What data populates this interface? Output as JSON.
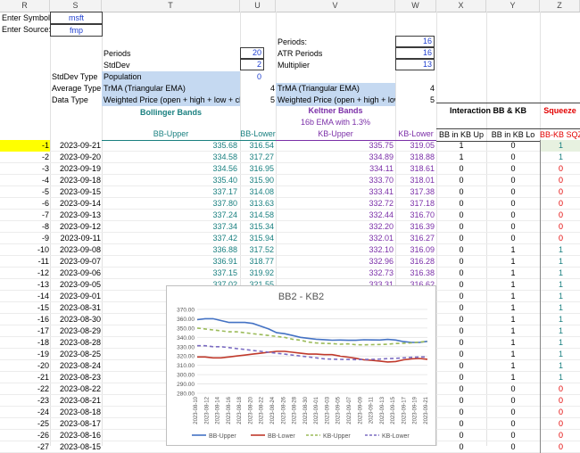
{
  "columns": [
    "R",
    "S",
    "T",
    "U",
    "V",
    "W",
    "X",
    "Y",
    "Z"
  ],
  "inputs": {
    "symbol_label": "Enter Symbol:",
    "symbol_value": "msft",
    "source_label": "Enter Source:",
    "source_value": "fmp"
  },
  "params_bb": {
    "periods_label": "Periods",
    "periods_value": "20",
    "stddev_label": "StdDev",
    "stddev_value": "2",
    "stddev_type_label": "StdDev Type",
    "stddev_type_value": "Population",
    "stddev_type_num": "0",
    "avg_type_label": "Average Type",
    "avg_type_value": "TrMA (Triangular EMA)",
    "avg_type_num": "4",
    "data_type_label": "Data Type",
    "data_type_value": "Weighted Price (open + high + low + clos",
    "data_type_num": "5"
  },
  "params_kb": {
    "periods_label": "Periods:",
    "periods_value": "16",
    "atr_label": "ATR Periods",
    "atr_value": "16",
    "mult_label": "Multiplier",
    "mult_value": "13",
    "avg_type_value": "TrMA (Triangular EMA)",
    "avg_type_num": "4",
    "data_type_value": "Weighted Price (open + high + low +",
    "data_type_num": "5"
  },
  "section_titles": {
    "bollinger": "Bollinger Bands",
    "keltner": "Keltner Bands",
    "keltner_sub": "16b EMA with 1.3%",
    "interaction": "Interaction BB & KB",
    "squeeze": "Squeeze"
  },
  "headers": {
    "bb_upper": "BB-Upper",
    "bb_lower": "BB-Lower",
    "kb_upper": "KB-Upper",
    "kb_lower": "KB-Lower",
    "bb_in_kb_up": "BB in KB Up",
    "bb_in_kb_lo": "BB in KB Lo",
    "sqz": "BB-KB SQZ"
  },
  "rows": [
    {
      "idx": "-1",
      "date": "2023-09-21",
      "bbu": "335.68",
      "bbl": "316.54",
      "kbu": "335.75",
      "kbl": "319.05",
      "up": "1",
      "lo": "0",
      "sqz": "1"
    },
    {
      "idx": "-2",
      "date": "2023-09-20",
      "bbu": "334.58",
      "bbl": "317.27",
      "kbu": "334.89",
      "kbl": "318.88",
      "up": "1",
      "lo": "0",
      "sqz": "1"
    },
    {
      "idx": "-3",
      "date": "2023-09-19",
      "bbu": "334.56",
      "bbl": "316.95",
      "kbu": "334.11",
      "kbl": "318.61",
      "up": "0",
      "lo": "0",
      "sqz": "0"
    },
    {
      "idx": "-4",
      "date": "2023-09-18",
      "bbu": "335.40",
      "bbl": "315.90",
      "kbu": "333.70",
      "kbl": "318.01",
      "up": "0",
      "lo": "0",
      "sqz": "0"
    },
    {
      "idx": "-5",
      "date": "2023-09-15",
      "bbu": "337.17",
      "bbl": "314.08",
      "kbu": "333.41",
      "kbl": "317.38",
      "up": "0",
      "lo": "0",
      "sqz": "0"
    },
    {
      "idx": "-6",
      "date": "2023-09-14",
      "bbu": "337.80",
      "bbl": "313.63",
      "kbu": "332.72",
      "kbl": "317.18",
      "up": "0",
      "lo": "0",
      "sqz": "0"
    },
    {
      "idx": "-7",
      "date": "2023-09-13",
      "bbu": "337.24",
      "bbl": "314.58",
      "kbu": "332.44",
      "kbl": "316.70",
      "up": "0",
      "lo": "0",
      "sqz": "0"
    },
    {
      "idx": "-8",
      "date": "2023-09-12",
      "bbu": "337.34",
      "bbl": "315.34",
      "kbu": "332.20",
      "kbl": "316.39",
      "up": "0",
      "lo": "0",
      "sqz": "0"
    },
    {
      "idx": "-9",
      "date": "2023-09-11",
      "bbu": "337.42",
      "bbl": "315.94",
      "kbu": "332.01",
      "kbl": "316.27",
      "up": "0",
      "lo": "0",
      "sqz": "0"
    },
    {
      "idx": "-10",
      "date": "2023-09-08",
      "bbu": "336.88",
      "bbl": "317.52",
      "kbu": "332.10",
      "kbl": "316.09",
      "up": "0",
      "lo": "1",
      "sqz": "1"
    },
    {
      "idx": "-11",
      "date": "2023-09-07",
      "bbu": "336.91",
      "bbl": "318.77",
      "kbu": "332.96",
      "kbl": "316.28",
      "up": "0",
      "lo": "1",
      "sqz": "1"
    },
    {
      "idx": "-12",
      "date": "2023-09-06",
      "bbu": "337.15",
      "bbl": "319.92",
      "kbu": "332.73",
      "kbl": "316.38",
      "up": "0",
      "lo": "1",
      "sqz": "1"
    },
    {
      "idx": "-13",
      "date": "2023-09-05",
      "bbu": "337.02",
      "bbl": "321.55",
      "kbu": "333.31",
      "kbl": "316.62",
      "up": "0",
      "lo": "1",
      "sqz": "1"
    },
    {
      "idx": "-14",
      "date": "2023-09-01",
      "bbu": "",
      "bbl": "",
      "kbu": "",
      "kbl": "",
      "up": "0",
      "lo": "1",
      "sqz": "1"
    },
    {
      "idx": "-15",
      "date": "2023-08-31",
      "bbu": "",
      "bbl": "",
      "kbu": "",
      "kbl": "",
      "up": "0",
      "lo": "1",
      "sqz": "1"
    },
    {
      "idx": "-16",
      "date": "2023-08-30",
      "bbu": "",
      "bbl": "",
      "kbu": "",
      "kbl": "",
      "up": "0",
      "lo": "1",
      "sqz": "1"
    },
    {
      "idx": "-17",
      "date": "2023-08-29",
      "bbu": "",
      "bbl": "",
      "kbu": "",
      "kbl": "",
      "up": "0",
      "lo": "1",
      "sqz": "1"
    },
    {
      "idx": "-18",
      "date": "2023-08-28",
      "bbu": "",
      "bbl": "",
      "kbu": "",
      "kbl": "",
      "up": "0",
      "lo": "1",
      "sqz": "1"
    },
    {
      "idx": "-19",
      "date": "2023-08-25",
      "bbu": "",
      "bbl": "",
      "kbu": "",
      "kbl": "",
      "up": "0",
      "lo": "1",
      "sqz": "1"
    },
    {
      "idx": "-20",
      "date": "2023-08-24",
      "bbu": "",
      "bbl": "",
      "kbu": "",
      "kbl": "",
      "up": "0",
      "lo": "1",
      "sqz": "1"
    },
    {
      "idx": "-21",
      "date": "2023-08-23",
      "bbu": "",
      "bbl": "",
      "kbu": "",
      "kbl": "",
      "up": "0",
      "lo": "1",
      "sqz": "1"
    },
    {
      "idx": "-22",
      "date": "2023-08-22",
      "bbu": "",
      "bbl": "",
      "kbu": "",
      "kbl": "",
      "up": "0",
      "lo": "0",
      "sqz": "0"
    },
    {
      "idx": "-23",
      "date": "2023-08-21",
      "bbu": "",
      "bbl": "",
      "kbu": "",
      "kbl": "",
      "up": "0",
      "lo": "0",
      "sqz": "0"
    },
    {
      "idx": "-24",
      "date": "2023-08-18",
      "bbu": "",
      "bbl": "",
      "kbu": "",
      "kbl": "",
      "up": "0",
      "lo": "0",
      "sqz": "0"
    },
    {
      "idx": "-25",
      "date": "2023-08-17",
      "bbu": "",
      "bbl": "",
      "kbu": "",
      "kbl": "",
      "up": "0",
      "lo": "0",
      "sqz": "0"
    },
    {
      "idx": "-26",
      "date": "2023-08-16",
      "bbu": "",
      "bbl": "",
      "kbu": "",
      "kbl": "",
      "up": "0",
      "lo": "0",
      "sqz": "0"
    },
    {
      "idx": "-27",
      "date": "2023-08-15",
      "bbu": "",
      "bbl": "",
      "kbu": "",
      "kbl": "",
      "up": "0",
      "lo": "0",
      "sqz": "0"
    }
  ],
  "colors": {
    "highlight": "#ffff00",
    "header_fill": "#c5d9f1",
    "teal": "#1a8080",
    "bb_upper": "#4472c4",
    "bb_lower": "#c0392b",
    "kb_upper": "#9bbb59",
    "kb_lower": "#7b6cc2"
  },
  "chart_data": {
    "type": "line",
    "title": "BB2 - KB2",
    "x": [
      "2023-08-10",
      "2023-08-11",
      "2023-08-14",
      "2023-08-15",
      "2023-08-16",
      "2023-08-17",
      "2023-08-18",
      "2023-08-21",
      "2023-08-22",
      "2023-08-23",
      "2023-08-24",
      "2023-08-25",
      "2023-08-28",
      "2023-08-29",
      "2023-08-30",
      "2023-08-31",
      "2023-09-01",
      "2023-09-05",
      "2023-09-06",
      "2023-09-07",
      "2023-09-08",
      "2023-09-11",
      "2023-09-12",
      "2023-09-13",
      "2023-09-14",
      "2023-09-15",
      "2023-09-18",
      "2023-09-19",
      "2023-09-20",
      "2023-09-21"
    ],
    "xlabels": [
      "2023-08-10",
      "2023-08-12",
      "2023-08-14",
      "2023-08-16",
      "2023-08-18",
      "2023-08-20",
      "2023-08-22",
      "2023-08-24",
      "2023-08-26",
      "2023-08-28",
      "2023-08-30",
      "2023-09-01",
      "2023-09-03",
      "2023-09-05",
      "2023-09-07",
      "2023-09-09",
      "2023-09-11",
      "2023-09-13",
      "2023-09-15",
      "2023-09-17",
      "2023-09-19",
      "2023-09-21"
    ],
    "ylim": [
      280,
      370
    ],
    "yticks": [
      "370.00",
      "360.00",
      "350.00",
      "340.00",
      "330.00",
      "320.00",
      "310.00",
      "300.00",
      "290.00",
      "280.00"
    ],
    "series": [
      {
        "name": "BB-Upper",
        "values": [
          359,
          360,
          360,
          358,
          356,
          356,
          356,
          355,
          352,
          349,
          345,
          344,
          342,
          340,
          339,
          338,
          337.5,
          337,
          337.2,
          336.9,
          336.9,
          337.4,
          337.3,
          337.2,
          337.8,
          337.2,
          335.4,
          334.6,
          334.6,
          335.7
        ]
      },
      {
        "name": "BB-Lower",
        "values": [
          319,
          319,
          318,
          318,
          319,
          320,
          321,
          322,
          323,
          324,
          325,
          325,
          324,
          323,
          322,
          322,
          321.5,
          321.5,
          319.9,
          318.8,
          317.5,
          315.9,
          315.3,
          314.6,
          313.6,
          314.1,
          315.9,
          317,
          317.3,
          316.5
        ]
      },
      {
        "name": "KB-Upper",
        "values": [
          350,
          349,
          348,
          347,
          346,
          346,
          345,
          344,
          343,
          342,
          341,
          340,
          338,
          337,
          335,
          334,
          333.5,
          333.3,
          332.7,
          333,
          332.1,
          332,
          332.2,
          332.4,
          332.7,
          333.4,
          333.7,
          334.1,
          334.9,
          335.8
        ]
      },
      {
        "name": "KB-Lower",
        "values": [
          331,
          331,
          330,
          330,
          329,
          328,
          327,
          326,
          325,
          324,
          323,
          322,
          321,
          320,
          319,
          318,
          317,
          316.6,
          316.4,
          316.3,
          316.1,
          316.3,
          316.4,
          316.7,
          317.2,
          317.4,
          318,
          318.6,
          318.9,
          319.1
        ]
      }
    ],
    "legend": "bottom"
  }
}
